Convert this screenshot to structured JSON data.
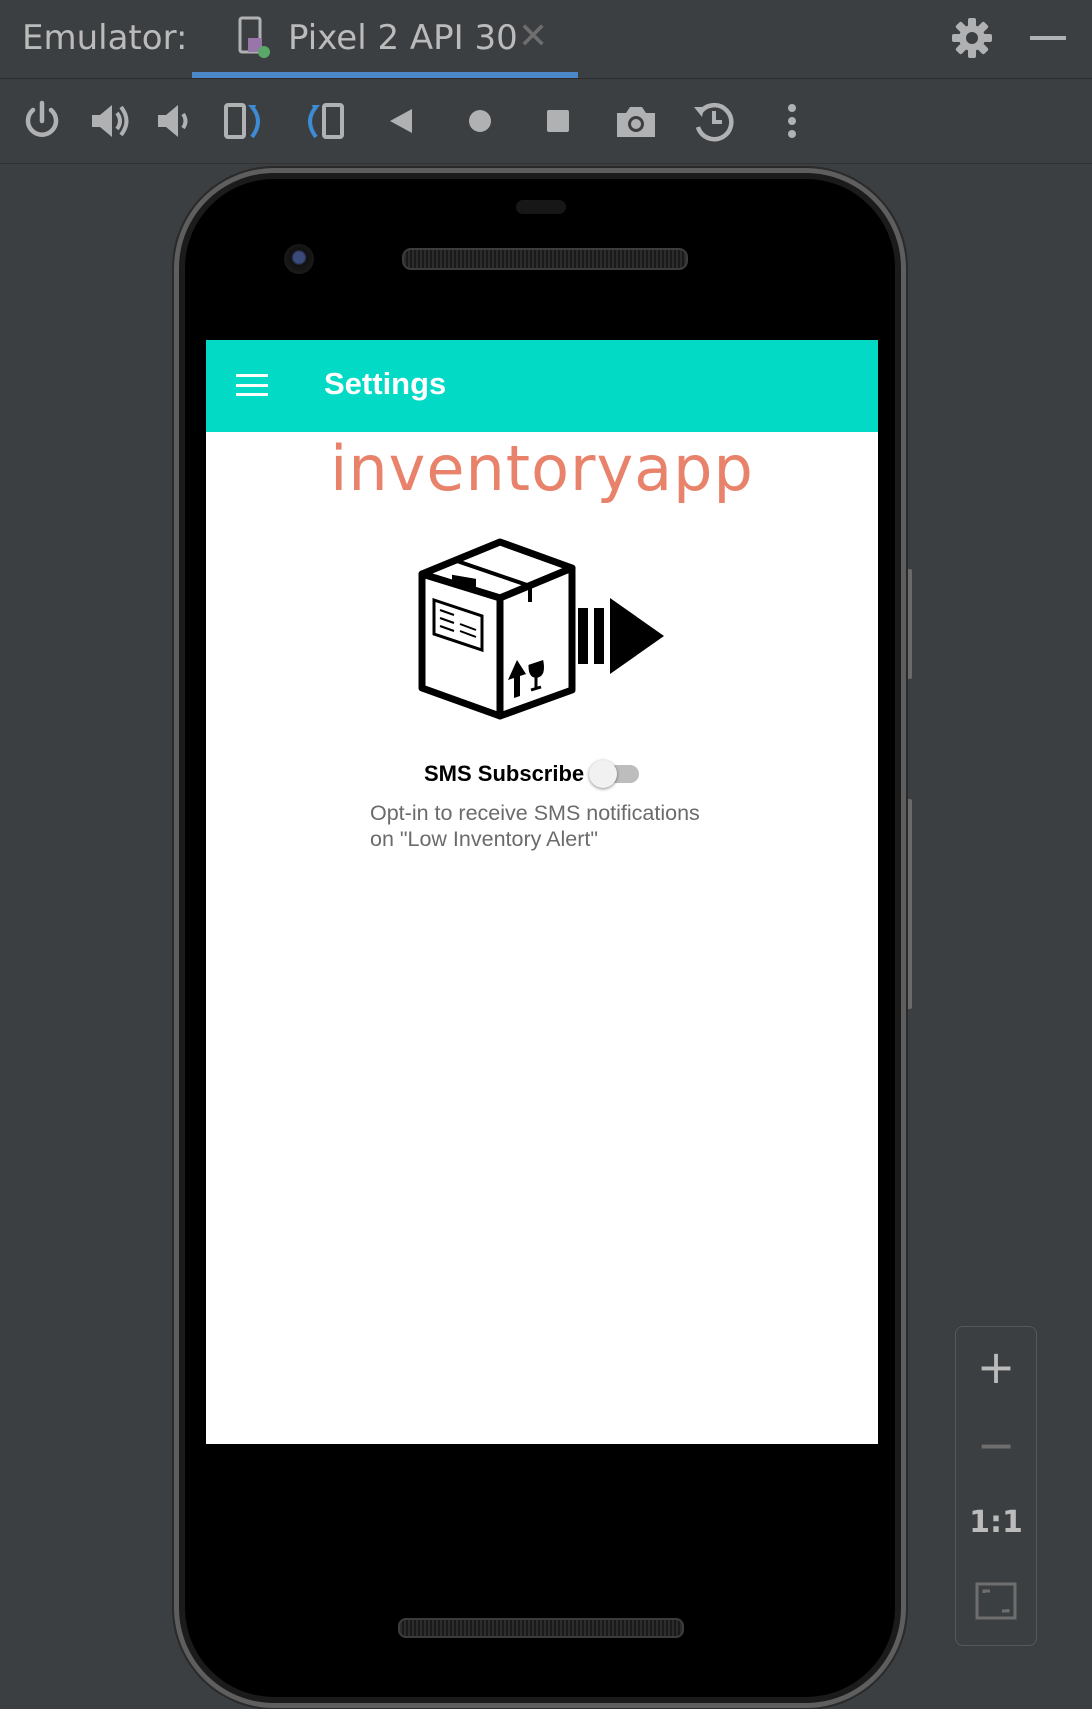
{
  "toolwindow": {
    "label": "Emulator:",
    "device_tab": "Pixel 2 API 30",
    "close_glyph": "✕"
  },
  "toolbar": {
    "buttons": [
      "power-icon",
      "volume-up-icon",
      "volume-down-icon",
      "rotate-left-icon",
      "rotate-right-icon",
      "back-icon",
      "home-icon",
      "overview-icon",
      "screenshot-icon",
      "snapshot-icon",
      "more-icon"
    ]
  },
  "app": {
    "title": "Settings",
    "logo_text": "inventoryapp",
    "sms_label": "SMS Subscribe",
    "sms_toggle_on": false,
    "sms_description": "Opt-in to receive SMS notifications on \"Low Inventory Alert\"",
    "appbar_color": "#03DAC5",
    "logo_color": "#E8826A"
  },
  "zoom": {
    "plus": "+",
    "minus": "−",
    "one_to_one": "1:1"
  }
}
